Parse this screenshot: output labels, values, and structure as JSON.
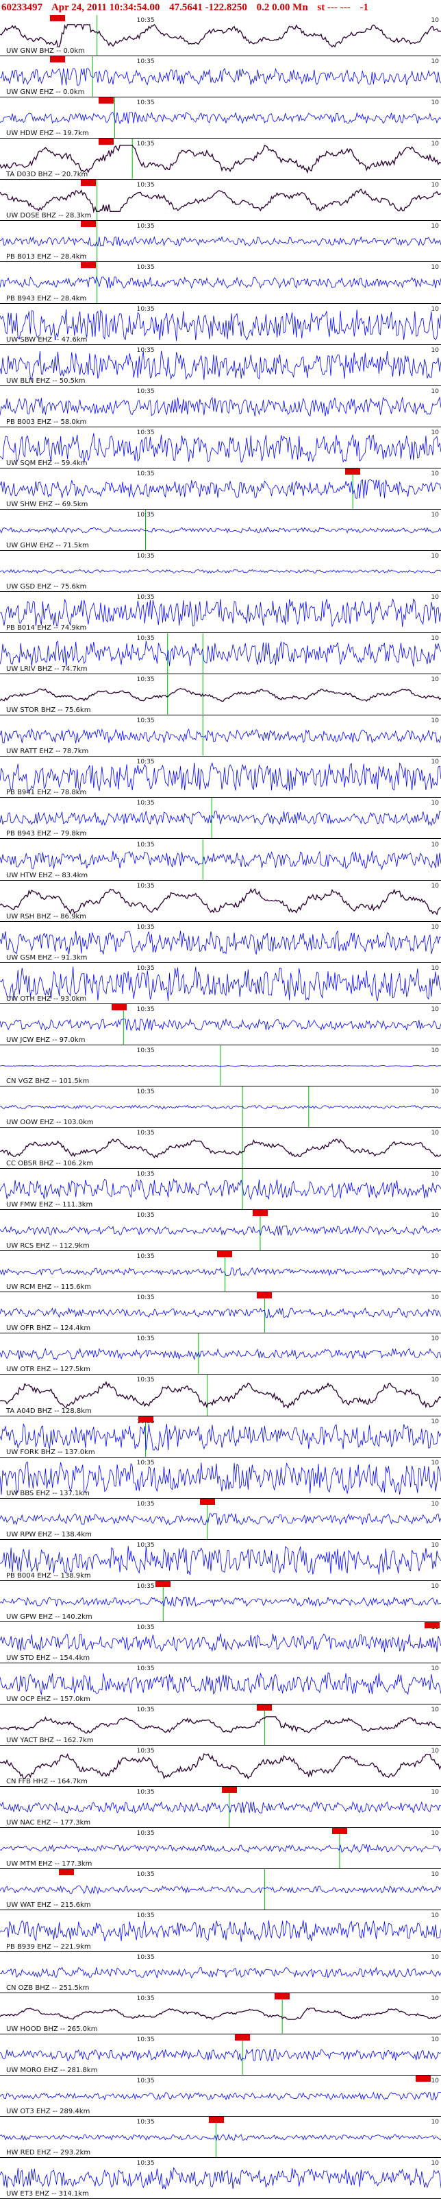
{
  "header": {
    "event_id": "60233497",
    "date": "Apr 24, 2011 10:34:54.00",
    "coords": "47.5641 -122.8250",
    "depth_mag": "0.2 0.00 Mn",
    "status": "st --- ---",
    "flag": "-1"
  },
  "axis": {
    "tick_label": "10:35",
    "edge_label": "10",
    "left_label": "10"
  },
  "colors": {
    "header_text": "#d00000",
    "trace_blue": "#0000ff",
    "trace_dark": "#2a0030",
    "pick_marker": "#e00000",
    "pick_line": "#00c000"
  },
  "stations": [
    {
      "label": "UW GNW BHZ -- 0.0km",
      "trace": "dark",
      "amp": 0.6,
      "pick": 0.13,
      "lines": [
        0.22
      ]
    },
    {
      "label": "UW GNW EHZ -- 0.0km",
      "trace": "blue",
      "amp": 0.45,
      "pick": 0.13,
      "lines": [
        0.21
      ]
    },
    {
      "label": "UW HDW EHZ -- 19.7km",
      "trace": "blue",
      "amp": 0.3,
      "pick": 0.24,
      "lines": [
        0.26
      ]
    },
    {
      "label": "TA D03D BHZ -- 20.7km",
      "trace": "dark",
      "amp": 0.75,
      "pick": 0.24,
      "lines": [
        0.3
      ]
    },
    {
      "label": "UW DOSE BHZ -- 28.3km",
      "trace": "dark",
      "amp": 0.6,
      "pick": 0.2,
      "lines": [
        0.22
      ]
    },
    {
      "label": "PB B013 EHZ -- 28.4km",
      "trace": "blue",
      "amp": 0.25,
      "pick": 0.2,
      "lines": [
        0.22
      ]
    },
    {
      "label": "PB B943 EHZ -- 28.4km",
      "trace": "blue",
      "amp": 0.3,
      "pick": 0.2,
      "lines": [
        0.22
      ]
    },
    {
      "label": "UW SBW EHZ -- 47.6km",
      "trace": "blue",
      "amp": 0.9,
      "pick": null,
      "lines": []
    },
    {
      "label": "UW BLN EHZ -- 50.5km",
      "trace": "blue",
      "amp": 0.8,
      "pick": null,
      "lines": []
    },
    {
      "label": "PB B003 EHZ -- 58.0km",
      "trace": "blue",
      "amp": 0.55,
      "pick": null,
      "lines": []
    },
    {
      "label": "UW SQM EHZ -- 59.4km",
      "trace": "blue",
      "amp": 0.8,
      "pick": null,
      "lines": []
    },
    {
      "label": "UW SHW EHZ -- 69.5km",
      "trace": "blue",
      "amp": 0.5,
      "pick": 0.8,
      "lines": [
        0.8
      ]
    },
    {
      "label": "UW GHW EHZ -- 71.5km",
      "trace": "blue",
      "amp": 0.15,
      "pick": null,
      "lines": [
        0.33
      ]
    },
    {
      "label": "UW GSD EHZ -- 75.6km",
      "trace": "blue",
      "amp": 0.1,
      "pick": null,
      "lines": []
    },
    {
      "label": "PB B014 EHZ -- 74.9km",
      "trace": "blue",
      "amp": 0.8,
      "pick": null,
      "lines": []
    },
    {
      "label": "UW LRIV BHZ -- 74.7km",
      "trace": "blue",
      "amp": 0.7,
      "pick": null,
      "lines": [
        0.38,
        0.46
      ]
    },
    {
      "label": "UW STOR BHZ -- 75.6km",
      "trace": "dark",
      "amp": 0.35,
      "pick": null,
      "lines": [
        0.38,
        0.46
      ]
    },
    {
      "label": "UW RATT EHZ -- 78.7km",
      "trace": "blue",
      "amp": 0.4,
      "pick": null,
      "lines": [
        0.46
      ]
    },
    {
      "label": "PB B941 EHZ -- 78.8km",
      "trace": "blue",
      "amp": 0.8,
      "pick": null,
      "lines": []
    },
    {
      "label": "PB B943 EHZ -- 79.8km",
      "trace": "blue",
      "amp": 0.4,
      "pick": null,
      "lines": [
        0.48
      ]
    },
    {
      "label": "UW HTW EHZ -- 83.4km",
      "trace": "blue",
      "amp": 0.5,
      "pick": null,
      "lines": [
        0.46
      ]
    },
    {
      "label": "UW RSH BHZ -- 86.9km",
      "trace": "dark",
      "amp": 0.7,
      "pick": null,
      "lines": []
    },
    {
      "label": "UW GSM EHZ -- 91.3km",
      "trace": "blue",
      "amp": 0.7,
      "pick": null,
      "lines": []
    },
    {
      "label": "UW OTH EHZ -- 93.0km",
      "trace": "blue",
      "amp": 0.95,
      "pick": null,
      "lines": []
    },
    {
      "label": "UW JCW EHZ -- 97.0km",
      "trace": "blue",
      "amp": 0.3,
      "pick": 0.27,
      "lines": [
        0.28
      ]
    },
    {
      "label": "CN VGZ BHZ -- 101.5km",
      "trace": "blue",
      "amp": 0.02,
      "pick": null,
      "lines": [
        0.5
      ]
    },
    {
      "label": "UW OOW EHZ -- 103.0km",
      "trace": "blue",
      "amp": 0.1,
      "pick": null,
      "lines": [
        0.55,
        0.7
      ]
    },
    {
      "label": "CC OBSR BHZ -- 106.2km",
      "trace": "dark",
      "amp": 0.5,
      "pick": null,
      "lines": [
        0.55
      ]
    },
    {
      "label": "UW FMW EHZ -- 111.3km",
      "trace": "blue",
      "amp": 0.55,
      "pick": null,
      "lines": [
        0.55
      ]
    },
    {
      "label": "UW RCS EHZ -- 112.9km",
      "trace": "blue",
      "amp": 0.25,
      "pick": 0.59,
      "lines": [
        0.59
      ]
    },
    {
      "label": "UW RCM EHZ -- 115.6km",
      "trace": "blue",
      "amp": 0.2,
      "pick": 0.51,
      "lines": [
        0.51
      ]
    },
    {
      "label": "UW OFR BHZ -- 124.4km",
      "trace": "blue",
      "amp": 0.25,
      "pick": 0.6,
      "lines": [
        0.6
      ]
    },
    {
      "label": "UW OTR EHZ -- 127.5km",
      "trace": "blue",
      "amp": 0.3,
      "pick": null,
      "lines": [
        0.45
      ]
    },
    {
      "label": "TA A04D BHZ -- 128.8km",
      "trace": "dark",
      "amp": 0.7,
      "pick": null,
      "lines": [
        0.47
      ]
    },
    {
      "label": "UW FORK BHZ -- 137.0km",
      "trace": "blue",
      "amp": 0.7,
      "pick": 0.33,
      "lines": [
        0.33
      ]
    },
    {
      "label": "UW BBS EHZ -- 137.1km",
      "trace": "blue",
      "amp": 0.9,
      "pick": null,
      "lines": []
    },
    {
      "label": "UW RPW EHZ -- 138.4km",
      "trace": "blue",
      "amp": 0.3,
      "pick": 0.47,
      "lines": [
        0.47
      ]
    },
    {
      "label": "PB B004 EHZ -- 138.9km",
      "trace": "blue",
      "amp": 0.8,
      "pick": null,
      "lines": []
    },
    {
      "label": "UW GPW EHZ -- 140.2km",
      "trace": "blue",
      "amp": 0.25,
      "pick": 0.37,
      "lines": [
        0.37
      ]
    },
    {
      "label": "UW STD EHZ -- 154.4km",
      "trace": "blue",
      "amp": 0.5,
      "pick": 0.99,
      "lines": []
    },
    {
      "label": "UW OCP EHZ -- 157.0km",
      "trace": "blue",
      "amp": 0.6,
      "pick": null,
      "lines": []
    },
    {
      "label": "UW YACT BHZ -- 162.7km",
      "trace": "dark",
      "amp": 0.45,
      "pick": 0.6,
      "lines": [
        0.6
      ]
    },
    {
      "label": "CN FFB HHZ -- 164.7km",
      "trace": "dark",
      "amp": 0.7,
      "pick": null,
      "lines": []
    },
    {
      "label": "UW NAC EHZ -- 177.3km",
      "trace": "blue",
      "amp": 0.3,
      "pick": 0.52,
      "lines": [
        0.52
      ]
    },
    {
      "label": "UW MTM EHZ -- 177.3km",
      "trace": "blue",
      "amp": 0.2,
      "pick": 0.77,
      "lines": [
        0.77
      ]
    },
    {
      "label": "UW WAT EHZ -- 215.6km",
      "trace": "blue",
      "amp": 0.2,
      "pick": 0.15,
      "lines": [
        0.6
      ]
    },
    {
      "label": "PB B939 EHZ -- 221.9km",
      "trace": "blue",
      "amp": 0.6,
      "pick": null,
      "lines": []
    },
    {
      "label": "CN OZB BHZ -- 251.5km",
      "trace": "blue",
      "amp": 0.3,
      "pick": null,
      "lines": []
    },
    {
      "label": "UW HOOD BHZ -- 265.0km",
      "trace": "dark",
      "amp": 0.3,
      "pick": 0.64,
      "lines": [
        0.64
      ]
    },
    {
      "label": "UW MORO EHZ -- 281.8km",
      "trace": "blue",
      "amp": 0.3,
      "pick": 0.55,
      "lines": [
        0.55
      ]
    },
    {
      "label": "UW OT3 EHZ -- 289.4km",
      "trace": "blue",
      "amp": 0.2,
      "pick": 0.96,
      "lines": []
    },
    {
      "label": "HW RED EHZ -- 293.2km",
      "trace": "blue",
      "amp": 0.15,
      "pick": 0.49,
      "lines": [
        0.49
      ]
    },
    {
      "label": "UW ET3 EHZ -- 314.1km",
      "trace": "blue",
      "amp": 0.6,
      "pick": null,
      "lines": []
    }
  ]
}
